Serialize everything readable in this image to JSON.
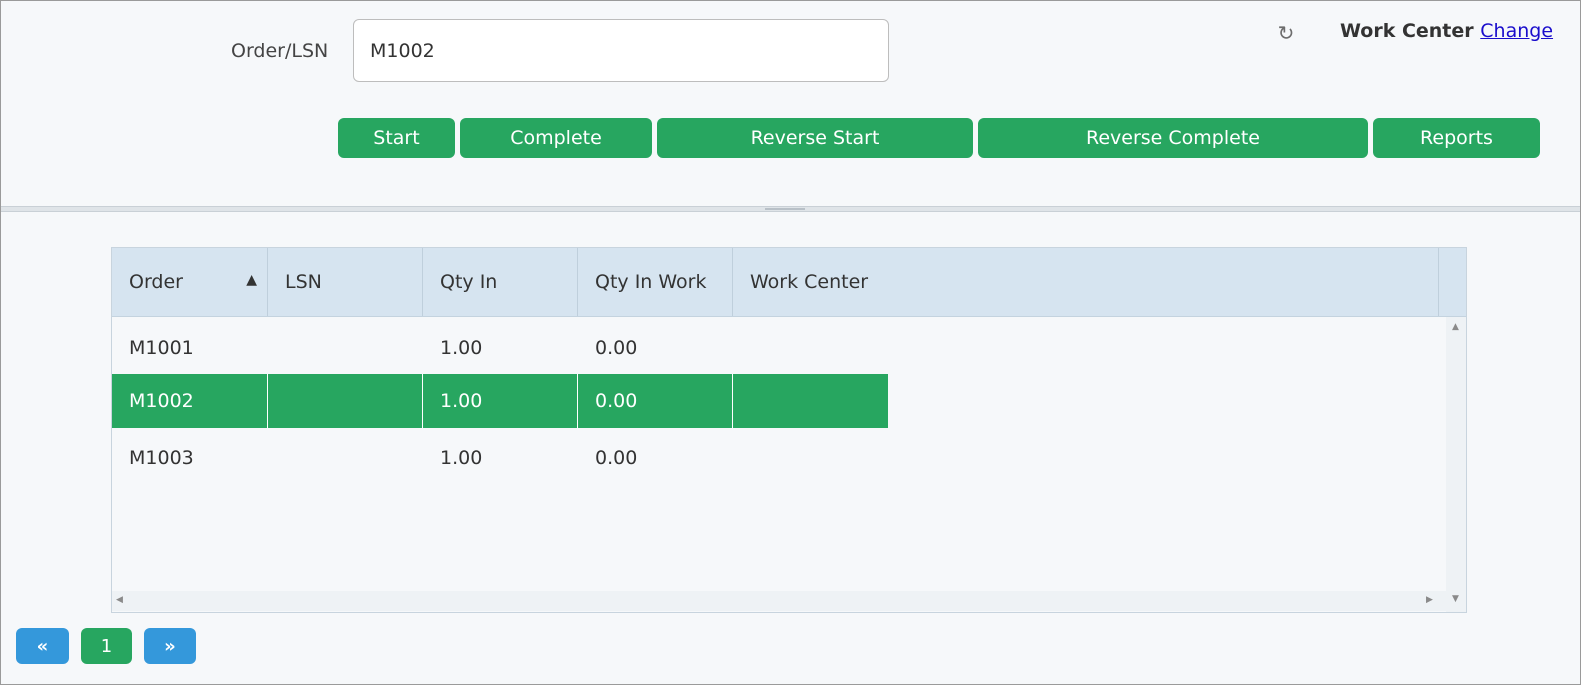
{
  "form": {
    "order_label": "Order/LSN",
    "order_value": "M1002"
  },
  "header": {
    "refresh_icon": "refresh-icon",
    "work_center_label": "Work Center",
    "change_link": "Change"
  },
  "actions": {
    "start": "Start",
    "complete": "Complete",
    "reverse_start": "Reverse Start",
    "reverse_complete": "Reverse Complete",
    "reports": "Reports"
  },
  "grid": {
    "columns": [
      "Order",
      "LSN",
      "Qty In",
      "Qty In Work",
      "Work Center"
    ],
    "sort": {
      "column": "Order",
      "direction": "ascending",
      "icon": "sort-asc-icon"
    },
    "rows": [
      {
        "order": "M1001",
        "lsn": "",
        "qty_in": "1.00",
        "qty_in_work": "0.00",
        "work_center": "",
        "selected": false
      },
      {
        "order": "M1002",
        "lsn": "",
        "qty_in": "1.00",
        "qty_in_work": "0.00",
        "work_center": "",
        "selected": true
      },
      {
        "order": "M1003",
        "lsn": "",
        "qty_in": "1.00",
        "qty_in_work": "0.00",
        "work_center": "",
        "selected": false
      }
    ]
  },
  "pager": {
    "prev_icon": "«",
    "current_page": "1",
    "next_icon": "»"
  },
  "colors": {
    "accent_green": "#27a660",
    "accent_blue": "#3498db",
    "header_bg": "#d6e4f0",
    "link": "#1a0dcc"
  }
}
